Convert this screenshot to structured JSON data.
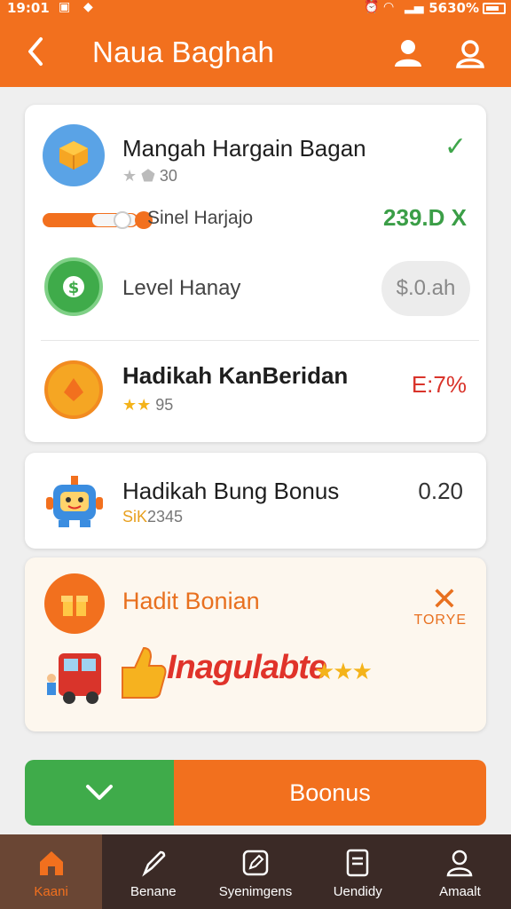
{
  "status": {
    "time": "19:01",
    "battery": "5630%"
  },
  "header": {
    "title": "Naua Baghah"
  },
  "card1": {
    "row1": {
      "title": "Mangah Hargain Bagan",
      "count": "30"
    },
    "slider": {
      "label": "Sinel Harjajo",
      "percent_text": "239.D X",
      "level": 0.85
    },
    "row2": {
      "title": "Level Hanay",
      "pill": "$.0.ah"
    },
    "row3": {
      "title": "Hadikah KanBeridan",
      "stars": "★★",
      "count": "95",
      "value": "E:7%"
    }
  },
  "card2": {
    "title": "Hadikah Bung Bonus",
    "sub_prefix": "SiK",
    "sub": "2345",
    "value": "0.20"
  },
  "card3": {
    "title": "Hadit Bonian",
    "close_label": "TORYE",
    "promo_text": "Inagulabte",
    "promo_stars": "★★★"
  },
  "action": {
    "label": "Boonus"
  },
  "nav": {
    "items": [
      {
        "label": "Kaani"
      },
      {
        "label": "Benane"
      },
      {
        "label": "Syenimgens"
      },
      {
        "label": "Uendidy"
      },
      {
        "label": "Amaalt"
      }
    ]
  },
  "colors": {
    "brand": "#f2701e",
    "success": "#3fab4a",
    "danger": "#d9342b",
    "nav_bg": "#3b2a26"
  }
}
